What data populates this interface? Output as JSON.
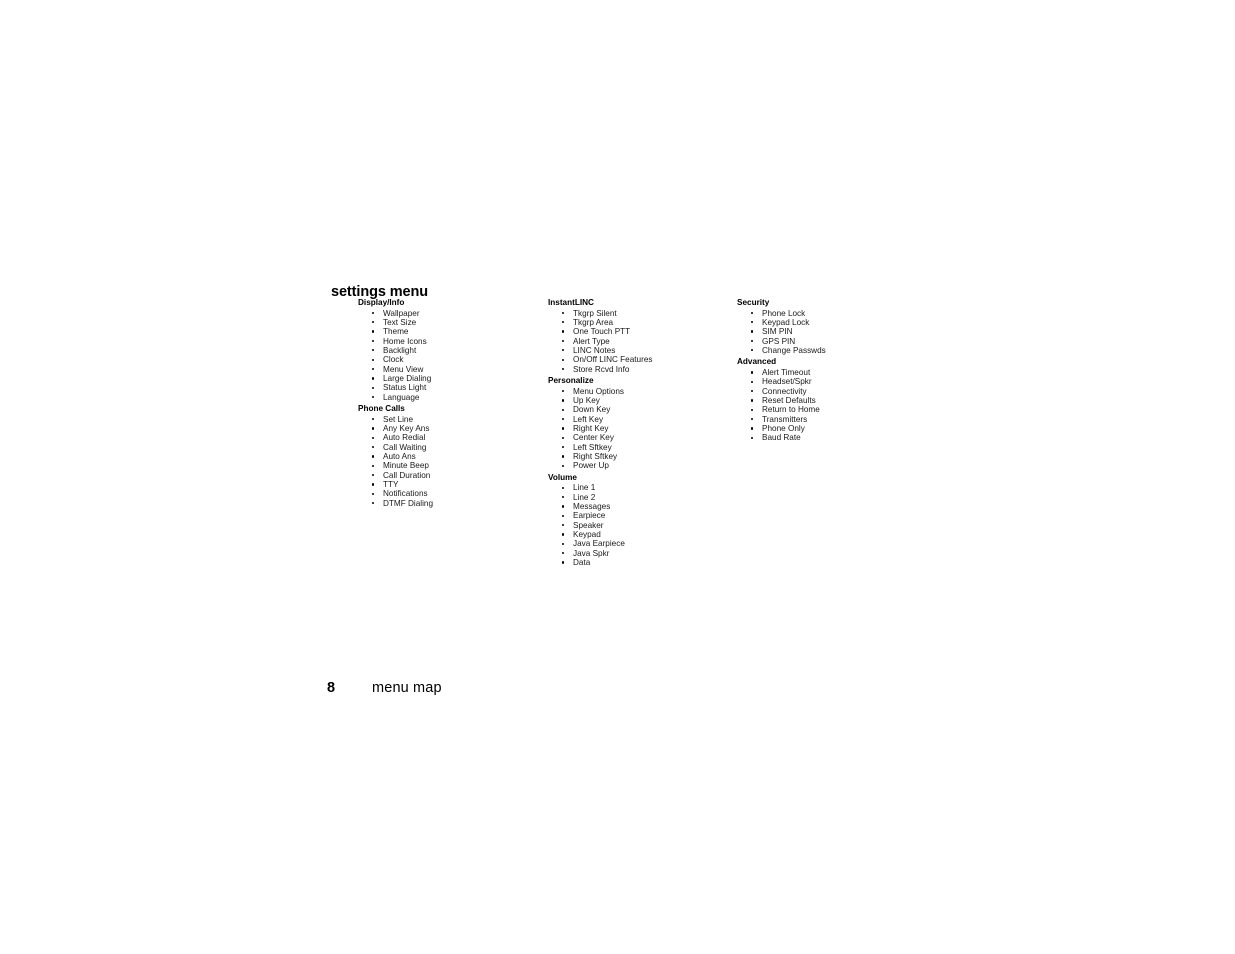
{
  "document": {
    "title": "settings menu",
    "footer": {
      "page_number": "8",
      "label": "menu map"
    }
  },
  "columns": [
    {
      "name": "column-1",
      "groups": [
        {
          "title": "Display/Info",
          "items": [
            "Wallpaper",
            "Text Size",
            "Theme",
            "Home Icons",
            "Backlight",
            "Clock",
            "Menu View",
            "Large Dialing",
            "Status Light",
            "Language"
          ]
        },
        {
          "title": "Phone Calls",
          "items": [
            "Set Line",
            "Any Key Ans",
            "Auto Redial",
            "Call Waiting",
            "Auto Ans",
            "Minute Beep",
            "Call Duration",
            "TTY",
            "Notifications",
            "DTMF Dialing"
          ]
        }
      ]
    },
    {
      "name": "column-2",
      "groups": [
        {
          "title": "InstantLINC",
          "items": [
            "Tkgrp Silent",
            "Tkgrp Area",
            "One Touch PTT",
            "Alert Type",
            "LINC Notes",
            "On/Off LINC Features",
            "Store Rcvd Info"
          ]
        },
        {
          "title": "Personalize",
          "items": [
            "Menu Options",
            "Up Key",
            "Down Key",
            "Left Key",
            "Right Key",
            "Center Key",
            "Left Sftkey",
            "Right Sftkey",
            "Power Up"
          ]
        },
        {
          "title": "Volume",
          "items": [
            "Line 1",
            "Line 2",
            "Messages",
            "Earpiece",
            "Speaker",
            "Keypad",
            "Java Earpiece",
            "Java Spkr",
            "Data"
          ]
        }
      ]
    },
    {
      "name": "column-3",
      "groups": [
        {
          "title": "Security",
          "items": [
            "Phone Lock",
            "Keypad Lock",
            "SIM PIN",
            "GPS PIN",
            "Change Passwds"
          ]
        },
        {
          "title": "Advanced",
          "items": [
            "Alert Timeout",
            "Headset/Spkr",
            "Connectivity",
            "Reset Defaults",
            "Return to Home",
            "Transmitters",
            "Phone Only",
            "Baud Rate"
          ]
        }
      ]
    }
  ]
}
